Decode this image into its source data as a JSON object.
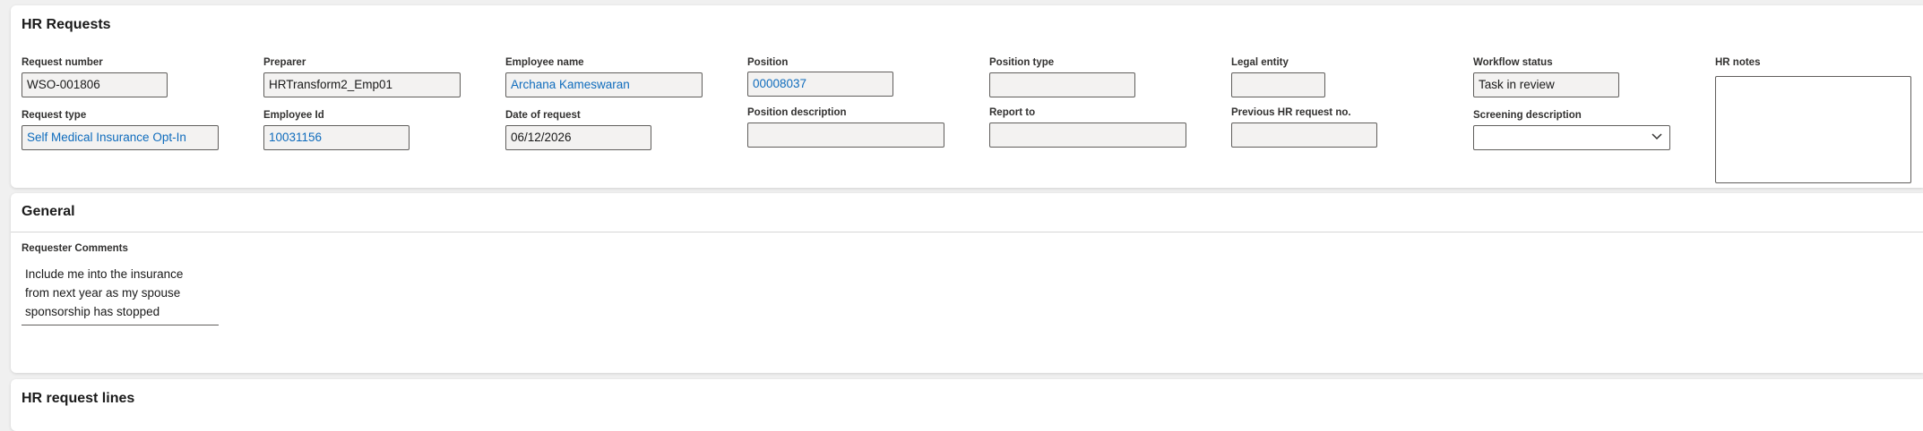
{
  "hr_requests": {
    "title": "HR Requests",
    "fields": {
      "request_number": {
        "label": "Request number",
        "value": "WSO-001806"
      },
      "preparer": {
        "label": "Preparer",
        "value": "HRTransform2_Emp01"
      },
      "employee_name": {
        "label": "Employee name",
        "value": "Archana Kameswaran"
      },
      "position": {
        "label": "Position",
        "value": "00008037"
      },
      "position_type": {
        "label": "Position type",
        "value": ""
      },
      "legal_entity": {
        "label": "Legal entity",
        "value": ""
      },
      "workflow_status": {
        "label": "Workflow status",
        "value": "Task in review"
      },
      "hr_notes": {
        "label": "HR notes",
        "value": ""
      },
      "request_type": {
        "label": "Request type",
        "value": "Self Medical Insurance Opt-In"
      },
      "employee_id": {
        "label": "Employee Id",
        "value": "10031156"
      },
      "date_of_request": {
        "label": "Date of request",
        "value": "06/12/2026"
      },
      "position_description": {
        "label": "Position description",
        "value": ""
      },
      "report_to": {
        "label": "Report to",
        "value": ""
      },
      "previous_hr_request_no": {
        "label": "Previous HR request no.",
        "value": ""
      },
      "screening_description": {
        "label": "Screening description",
        "value": ""
      }
    }
  },
  "general": {
    "title": "General",
    "requester_comments_label": "Requester Comments",
    "requester_comments_lines": [
      "Include me into the insurance",
      "from next year as my spouse",
      "sponsorship has stopped"
    ]
  },
  "hr_request_lines": {
    "title": "HR request lines"
  },
  "icons": {
    "dropdown": "chevron-down-icon"
  },
  "colors": {
    "link": "#0f6cbd",
    "field_background": "#f3f2f1",
    "field_border": "#605e5c",
    "page_background": "#f0f0f0"
  }
}
